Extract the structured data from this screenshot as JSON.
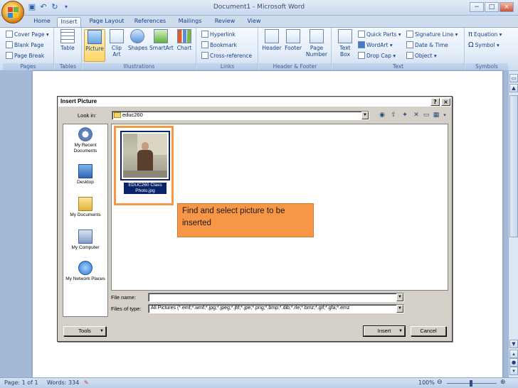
{
  "window": {
    "title": "Document1 - Microsoft Word",
    "controls": [
      "−",
      "□",
      "×"
    ]
  },
  "quick_access": [
    "save-icon",
    "undo-icon",
    "redo-icon",
    "customize-icon"
  ],
  "tabs": [
    "Home",
    "Insert",
    "Page Layout",
    "References",
    "Mailings",
    "Review",
    "View"
  ],
  "active_tab": "Insert",
  "ribbon": {
    "pages": {
      "label": "Pages",
      "items": [
        "Cover Page",
        "Blank Page",
        "Page Break"
      ]
    },
    "tables": {
      "label": "Tables",
      "items": [
        "Table"
      ]
    },
    "illustrations": {
      "label": "Illustrations",
      "items": [
        "Picture",
        "Clip Art",
        "Shapes",
        "SmartArt",
        "Chart"
      ]
    },
    "links": {
      "label": "Links",
      "items": [
        "Hyperlink",
        "Bookmark",
        "Cross-reference"
      ]
    },
    "header_footer": {
      "label": "Header & Footer",
      "items": [
        "Header",
        "Footer",
        "Page Number"
      ]
    },
    "text": {
      "label": "Text",
      "items": [
        "Text Box",
        "Quick Parts",
        "WordArt",
        "Drop Cap",
        "Signature Line",
        "Date & Time",
        "Object"
      ]
    },
    "symbols": {
      "label": "Symbols",
      "items": [
        "Equation",
        "Symbol"
      ]
    }
  },
  "dialog": {
    "title": "Insert Picture",
    "help": "?",
    "close": "×",
    "look_in_label": "Look in:",
    "look_in_value": "educ260",
    "places": [
      "My Recent Documents",
      "Desktop",
      "My Documents",
      "My Computer",
      "My Network Places"
    ],
    "files": [
      {
        "name": "EDUC260 Class Photo.jpg"
      }
    ],
    "file_name_label": "File name:",
    "file_name_value": "",
    "files_of_type_label": "Files of type:",
    "files_of_type_value": "All Pictures (*.emf;*.wmf;*.jpg;*.jpeg;*.jfif;*.jpe;*.png;*.bmp;*.dib;*.rle;*.bmz;*.gif;*.gfa;*.emz",
    "tools_label": "Tools",
    "insert_label": "Insert",
    "cancel_label": "Cancel"
  },
  "callout": "Find and select picture to be inserted",
  "status": {
    "page": "Page: 1 of 1",
    "words": "Words: 334",
    "zoom": "100%"
  }
}
